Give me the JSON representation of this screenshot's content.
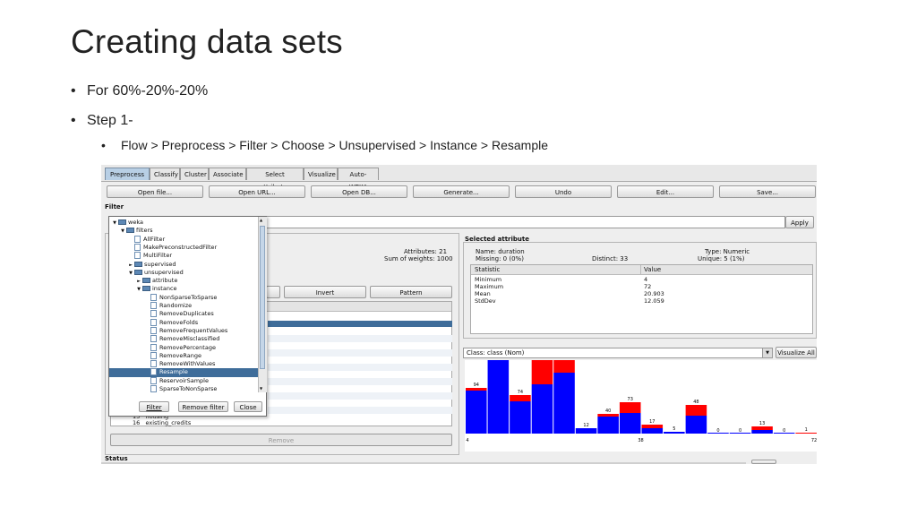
{
  "slide": {
    "title": "Creating data sets",
    "bullets": [
      "For 60%-20%-20%",
      "Step 1-"
    ],
    "sub_bullet": "Flow > Preprocess > Filter > Choose > Unsupervised > Instance > Resample",
    "bullet_glyph": "•"
  },
  "weka": {
    "tabs": [
      "Preprocess",
      "Classify",
      "Cluster",
      "Associate",
      "Select attributes",
      "Visualize",
      "Auto-WEKA"
    ],
    "active_tab": "Preprocess",
    "buttons": [
      "Open file...",
      "Open URL...",
      "Open DB...",
      "Generate...",
      "Undo",
      "Edit...",
      "Save..."
    ],
    "filter_label": "Filter",
    "apply_button": "Apply",
    "attributes_label": "Attributes: 21",
    "weights_label": "Sum of weights: 1000",
    "invert_button": "Invert",
    "pattern_button": "Pattern",
    "remove_button": "Remove",
    "status_label": "Status",
    "attr_list_tail": [
      {
        "num": "15",
        "name": "housing"
      },
      {
        "num": "16",
        "name": "existing_credits"
      }
    ],
    "selected_attribute": {
      "heading": "Selected attribute",
      "name": "Name: duration",
      "type": "Type: Numeric",
      "missing": "Missing: 0 (0%)",
      "distinct": "Distinct: 33",
      "unique": "Unique: 5 (1%)",
      "col_statistic": "Statistic",
      "col_value": "Value",
      "stats": [
        {
          "stat": "Minimum",
          "value": "4"
        },
        {
          "stat": "Maximum",
          "value": "72"
        },
        {
          "stat": "Mean",
          "value": "20.903"
        },
        {
          "stat": "StdDev",
          "value": "12.059"
        }
      ]
    },
    "class_select": "Class: class (Nom)",
    "visualize_all": "Visualize All",
    "popup": {
      "tree": [
        {
          "label": "weka",
          "kind": "folder",
          "depth": 0,
          "expanded": true
        },
        {
          "label": "filters",
          "kind": "folder",
          "depth": 1,
          "expanded": true
        },
        {
          "label": "AllFilter",
          "kind": "file",
          "depth": 2
        },
        {
          "label": "MakePreconstructedFilter",
          "kind": "file",
          "depth": 2
        },
        {
          "label": "MultiFilter",
          "kind": "file",
          "depth": 2
        },
        {
          "label": "supervised",
          "kind": "folder",
          "depth": 2,
          "expanded": false
        },
        {
          "label": "unsupervised",
          "kind": "folder",
          "depth": 2,
          "expanded": true
        },
        {
          "label": "attribute",
          "kind": "folder",
          "depth": 3,
          "expanded": false
        },
        {
          "label": "instance",
          "kind": "folder",
          "depth": 3,
          "expanded": true
        },
        {
          "label": "NonSparseToSparse",
          "kind": "file",
          "depth": 4
        },
        {
          "label": "Randomize",
          "kind": "file",
          "depth": 4
        },
        {
          "label": "RemoveDuplicates",
          "kind": "file",
          "depth": 4
        },
        {
          "label": "RemoveFolds",
          "kind": "file",
          "depth": 4
        },
        {
          "label": "RemoveFrequentValues",
          "kind": "file",
          "depth": 4
        },
        {
          "label": "RemoveMisclassified",
          "kind": "file",
          "depth": 4
        },
        {
          "label": "RemovePercentage",
          "kind": "file",
          "depth": 4
        },
        {
          "label": "RemoveRange",
          "kind": "file",
          "depth": 4
        },
        {
          "label": "RemoveWithValues",
          "kind": "file",
          "depth": 4
        },
        {
          "label": "Resample",
          "kind": "file",
          "depth": 4,
          "selected": true
        },
        {
          "label": "ReservoirSample",
          "kind": "file",
          "depth": 4
        },
        {
          "label": "SparseToNonSparse",
          "kind": "file",
          "depth": 4
        }
      ],
      "buttons": [
        "Filter",
        "Remove filter",
        "Close"
      ]
    },
    "histogram": {
      "colors": {
        "blue": "#0000ff",
        "red": "#ff0000"
      },
      "bins": [
        {
          "label": "94",
          "blue": 48,
          "red": 3
        },
        {
          "label": "266",
          "blue": 106,
          "red": 38
        },
        {
          "label": "74",
          "blue": 36,
          "red": 7
        },
        {
          "label": "187",
          "blue": 55,
          "red": 30
        },
        {
          "label": "189",
          "blue": 68,
          "red": 30
        },
        {
          "label": "12",
          "blue": 6,
          "red": 0
        },
        {
          "label": "40",
          "blue": 19,
          "red": 3
        },
        {
          "label": "73",
          "blue": 23,
          "red": 12
        },
        {
          "label": "17",
          "blue": 6,
          "red": 4
        },
        {
          "label": "5",
          "blue": 2,
          "red": 0
        },
        {
          "label": "48",
          "blue": 20,
          "red": 12
        },
        {
          "label": "0",
          "blue": 0,
          "red": 0
        },
        {
          "label": "0",
          "blue": 0,
          "red": 0
        },
        {
          "label": "13",
          "blue": 4,
          "red": 4
        },
        {
          "label": "0",
          "blue": 0,
          "red": 0
        },
        {
          "label": "1",
          "blue": 0,
          "red": 1
        }
      ],
      "axis_ticks": [
        "4",
        "38",
        "72"
      ]
    }
  }
}
